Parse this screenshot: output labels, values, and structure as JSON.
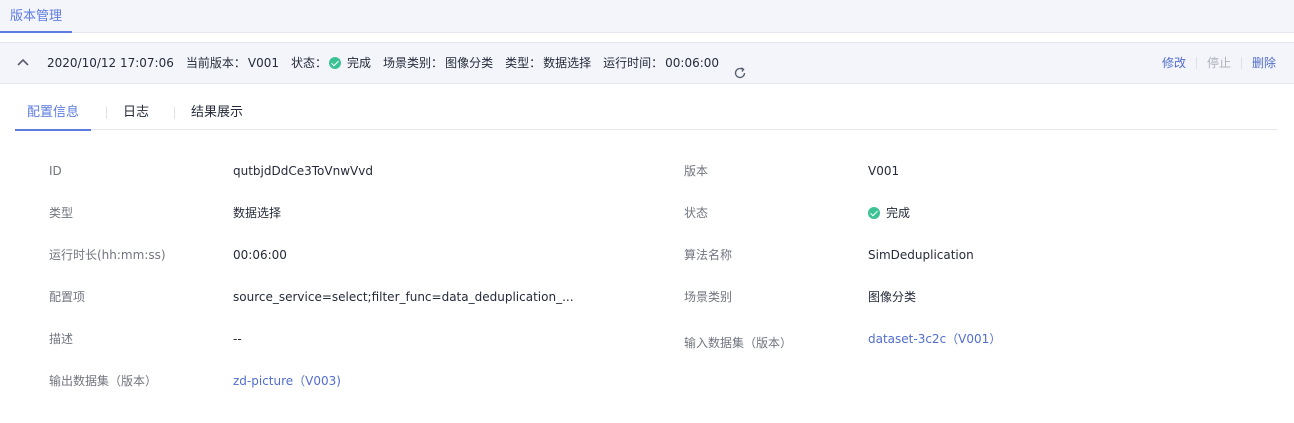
{
  "top_tab": {
    "label": "版本管理"
  },
  "version_bar": {
    "datetime": "2020/10/12 17:07:06",
    "current_version_label": "当前版本：",
    "current_version": "V001",
    "status_label": "状态：",
    "status": "完成",
    "scene_label": "场景类别：",
    "scene": "图像分类",
    "type_label": "类型：",
    "type": "数据选择",
    "runtime_label": "运行时间：",
    "runtime": "00:06:00",
    "actions": {
      "edit": "修改",
      "stop": "停止",
      "delete": "删除"
    }
  },
  "subtabs": [
    "配置信息",
    "日志",
    "结果展示"
  ],
  "details": {
    "left": [
      {
        "label": "ID",
        "value": "qutbjdDdCe3ToVnwVvd"
      },
      {
        "label": "类型",
        "value": "数据选择"
      },
      {
        "label": "运行时长(hh:mm:ss)",
        "value": "00:06:00"
      },
      {
        "label": "配置项",
        "value": "source_service=select;filter_func=data_deduplication_..."
      },
      {
        "label": "描述",
        "value": "--"
      },
      {
        "label": "输出数据集（版本）",
        "value": "zd-picture（V003)"
      }
    ],
    "right": [
      {
        "label": "版本",
        "value": "V001"
      },
      {
        "label": "状态",
        "value": "完成"
      },
      {
        "label": "算法名称",
        "value": "SimDeduplication"
      },
      {
        "label": "场景类别",
        "value": "图像分类"
      },
      {
        "label": "输入数据集（版本）",
        "value": "dataset-3c2c（V001）"
      }
    ]
  },
  "colors": {
    "accent": "#5e7ce0",
    "link": "#526ecc",
    "success": "#3ac295",
    "bar_bg": "#f3f5fb"
  }
}
